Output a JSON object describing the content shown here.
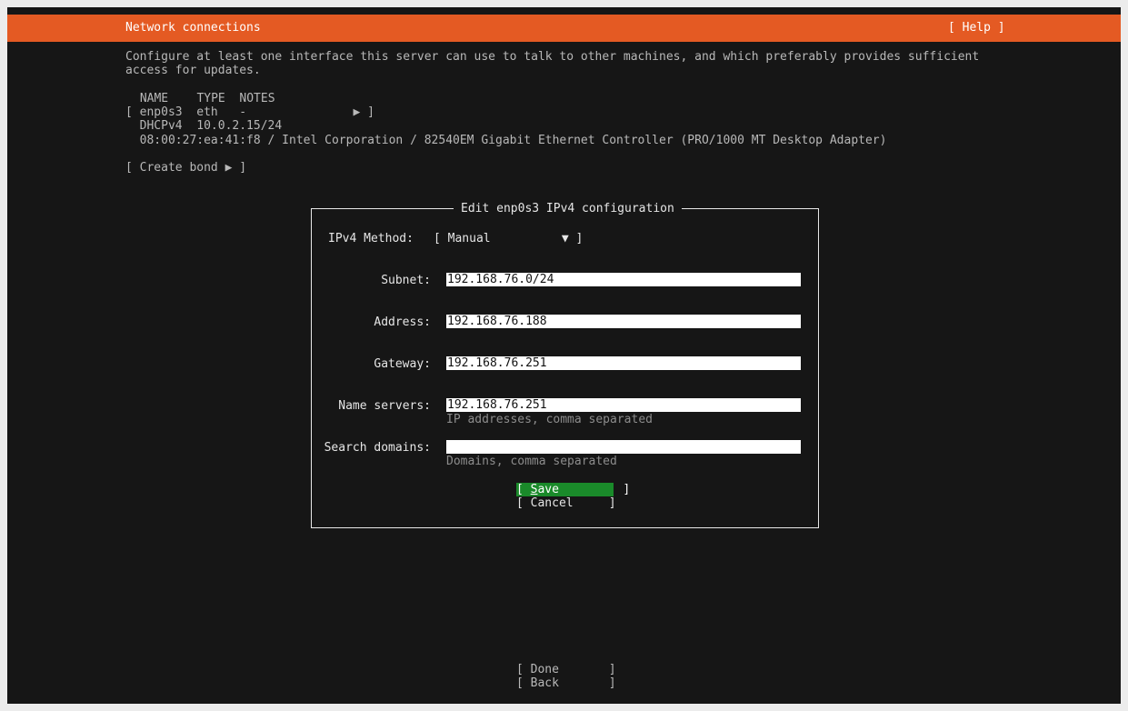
{
  "header": {
    "title": "Network connections",
    "help_label": "[ Help ]"
  },
  "intro": {
    "line1": "Configure at least one interface this server can use to talk to other machines, and which preferably provides sufficient",
    "line2": "access for updates."
  },
  "table": {
    "header": " NAME    TYPE  NOTES",
    "row": "[ enp0s3  eth   -               ▶ ]",
    "detail1": "  DHCPv4  10.0.2.15/24",
    "detail2": "  08:00:27:ea:41:f8 / Intel Corporation / 82540EM Gigabit Ethernet Controller (PRO/1000 MT Desktop Adapter)"
  },
  "create_bond_label": "[ Create bond ▶ ]",
  "dialog": {
    "title": "Edit enp0s3 IPv4 configuration",
    "method_label": "IPv4 Method:",
    "method_value": "[ Manual          ▼ ]",
    "subnet_label": "Subnet:",
    "subnet_value": "192.168.76.0/24",
    "address_label": "Address:",
    "address_value": "192.168.76.188",
    "gateway_label": "Gateway:",
    "gateway_value": "192.168.76.251",
    "nameservers_label": "Name servers:",
    "nameservers_value": "192.168.76.251",
    "nameservers_hint": "IP addresses, comma separated",
    "searchdomains_label": "Search domains:",
    "searchdomains_value": "",
    "searchdomains_hint": "Domains, comma separated",
    "save_open": "[ ",
    "save_hotkey": "S",
    "save_rest": "ave         ]",
    "cancel_label": "[ Cancel     ]"
  },
  "footer": {
    "done_label": "[ Done       ]",
    "back_label": "[ Back       ]"
  },
  "colors": {
    "header_bg": "#e45a23",
    "focus_bg": "#1a8a2a",
    "screen_bg": "#161616"
  }
}
